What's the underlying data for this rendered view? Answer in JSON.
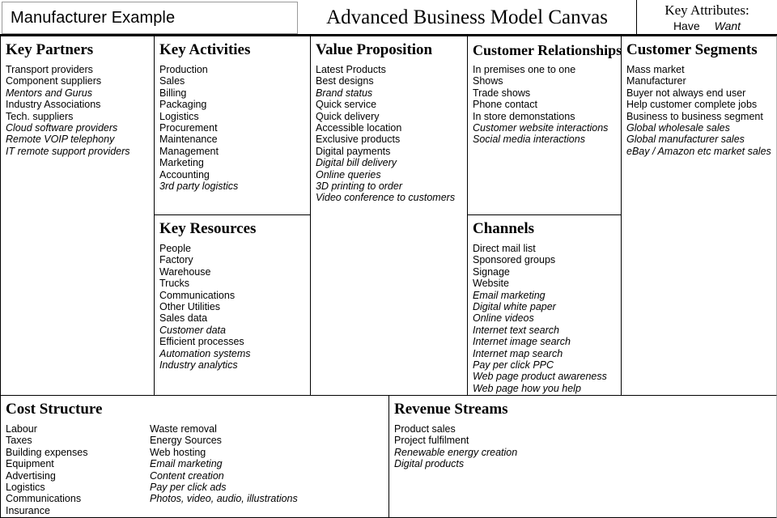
{
  "header": {
    "example_title": "Manufacturer Example",
    "main_title": "Advanced Business Model Canvas",
    "legend_title": "Key Attributes:",
    "legend_have": "Have",
    "legend_want": "Want"
  },
  "panels": {
    "key_partners": {
      "title": "Key Partners",
      "items": [
        {
          "text": "Transport providers",
          "attr": "have"
        },
        {
          "text": "Component suppliers",
          "attr": "have"
        },
        {
          "text": "Mentors and Gurus",
          "attr": "want"
        },
        {
          "text": "Industry Associations",
          "attr": "have"
        },
        {
          "text": "Tech. suppliers",
          "attr": "have"
        },
        {
          "text": "Cloud software providers",
          "attr": "want"
        },
        {
          "text": "Remote VOIP telephony",
          "attr": "want"
        },
        {
          "text": "IT remote support providers",
          "attr": "want"
        }
      ]
    },
    "key_activities": {
      "title": "Key Activities",
      "items": [
        {
          "text": "Production",
          "attr": "have"
        },
        {
          "text": "Sales",
          "attr": "have"
        },
        {
          "text": "Billing",
          "attr": "have"
        },
        {
          "text": "Packaging",
          "attr": "have"
        },
        {
          "text": "Logistics",
          "attr": "have"
        },
        {
          "text": "Procurement",
          "attr": "have"
        },
        {
          "text": "Maintenance",
          "attr": "have"
        },
        {
          "text": "Management",
          "attr": "have"
        },
        {
          "text": "Marketing",
          "attr": "have"
        },
        {
          "text": "Accounting",
          "attr": "have"
        },
        {
          "text": "3rd party logistics",
          "attr": "want"
        }
      ]
    },
    "key_resources": {
      "title": "Key Resources",
      "items": [
        {
          "text": "People",
          "attr": "have"
        },
        {
          "text": "Factory",
          "attr": "have"
        },
        {
          "text": "Warehouse",
          "attr": "have"
        },
        {
          "text": "Trucks",
          "attr": "have"
        },
        {
          "text": "Communications",
          "attr": "have"
        },
        {
          "text": "Other Utilities",
          "attr": "have"
        },
        {
          "text": "Sales data",
          "attr": "have"
        },
        {
          "text": "Customer data",
          "attr": "want"
        },
        {
          "text": "Efficient processes",
          "attr": "have"
        },
        {
          "text": "Automation systems",
          "attr": "want"
        },
        {
          "text": "Industry analytics",
          "attr": "want"
        }
      ]
    },
    "value_proposition": {
      "title": "Value Proposition",
      "items": [
        {
          "text": "Latest Products",
          "attr": "have"
        },
        {
          "text": "Best designs",
          "attr": "have"
        },
        {
          "text": "Brand status",
          "attr": "want"
        },
        {
          "text": "Quick service",
          "attr": "have"
        },
        {
          "text": "Quick delivery",
          "attr": "have"
        },
        {
          "text": "Accessible location",
          "attr": "have"
        },
        {
          "text": "Exclusive products",
          "attr": "have"
        },
        {
          "text": "Digital payments",
          "attr": "have"
        },
        {
          "text": "Digital bill delivery",
          "attr": "want"
        },
        {
          "text": "Online queries",
          "attr": "want"
        },
        {
          "text": "3D printing to order",
          "attr": "want"
        },
        {
          "text": "Video conference to customers",
          "attr": "want"
        }
      ]
    },
    "customer_relationships": {
      "title": "Customer Relationships",
      "items": [
        {
          "text": "In premises one to one",
          "attr": "have"
        },
        {
          "text": "Shows",
          "attr": "have"
        },
        {
          "text": "Trade shows",
          "attr": "have"
        },
        {
          "text": "Phone contact",
          "attr": "have"
        },
        {
          "text": "In store demonstations",
          "attr": "have"
        },
        {
          "text": "Customer website interactions",
          "attr": "want"
        },
        {
          "text": "Social media interactions",
          "attr": "want"
        }
      ]
    },
    "channels": {
      "title": "Channels",
      "items": [
        {
          "text": "Direct mail list",
          "attr": "have"
        },
        {
          "text": "Sponsored groups",
          "attr": "have"
        },
        {
          "text": "Signage",
          "attr": "have"
        },
        {
          "text": "Website",
          "attr": "have"
        },
        {
          "text": "Email marketing",
          "attr": "want"
        },
        {
          "text": "Digital white paper",
          "attr": "want"
        },
        {
          "text": "Online videos",
          "attr": "want"
        },
        {
          "text": "Internet text search",
          "attr": "want"
        },
        {
          "text": "Internet image search",
          "attr": "want"
        },
        {
          "text": "Internet map search",
          "attr": "want"
        },
        {
          "text": "Pay per click PPC",
          "attr": "want"
        },
        {
          "text": "Web page product awareness",
          "attr": "want"
        },
        {
          "text": "Web page how you help",
          "attr": "want"
        }
      ]
    },
    "customer_segments": {
      "title": "Customer Segments",
      "items": [
        {
          "text": "Mass market",
          "attr": "have"
        },
        {
          "text": "Manufacturer",
          "attr": "have"
        },
        {
          "text": "Buyer not always end user",
          "attr": "have"
        },
        {
          "text": "Help customer complete jobs",
          "attr": "have"
        },
        {
          "text": "Business to business segment",
          "attr": "have"
        },
        {
          "text": "Global wholesale sales",
          "attr": "want"
        },
        {
          "text": "Global manufacturer sales",
          "attr": "want"
        },
        {
          "text": "eBay / Amazon etc market sales",
          "attr": "want"
        }
      ]
    },
    "cost_structure": {
      "title": "Cost Structure",
      "items_col1": [
        {
          "text": "Labour",
          "attr": "have"
        },
        {
          "text": "Taxes",
          "attr": "have"
        },
        {
          "text": "Building expenses",
          "attr": "have"
        },
        {
          "text": "Equipment",
          "attr": "have"
        },
        {
          "text": "Advertising",
          "attr": "have"
        },
        {
          "text": "Logistics",
          "attr": "have"
        },
        {
          "text": "Communications",
          "attr": "have"
        },
        {
          "text": "Insurance",
          "attr": "have"
        }
      ],
      "items_col2": [
        {
          "text": "Waste removal",
          "attr": "have"
        },
        {
          "text": "Energy Sources",
          "attr": "have"
        },
        {
          "text": "Web hosting",
          "attr": "have"
        },
        {
          "text": "Email marketing",
          "attr": "want"
        },
        {
          "text": "Content creation",
          "attr": "want"
        },
        {
          "text": "Pay per click ads",
          "attr": "want"
        },
        {
          "text": "Photos, video, audio, illustrations",
          "attr": "want"
        }
      ]
    },
    "revenue_streams": {
      "title": "Revenue Streams",
      "items": [
        {
          "text": "Product sales",
          "attr": "have"
        },
        {
          "text": "Project fulfilment",
          "attr": "have"
        },
        {
          "text": "Renewable energy creation",
          "attr": "want"
        },
        {
          "text": "Digital products",
          "attr": "want"
        }
      ]
    }
  }
}
